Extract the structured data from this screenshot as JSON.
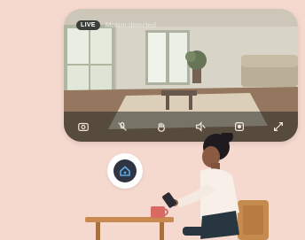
{
  "camera": {
    "live_label": "LIVE",
    "status_text": "Motion detected",
    "controls": [
      {
        "name": "snapshot",
        "icon": "camera-icon"
      },
      {
        "name": "mute-mic",
        "icon": "mic-off-icon"
      },
      {
        "name": "talk",
        "icon": "hand-icon"
      },
      {
        "name": "volume",
        "icon": "speaker-icon"
      },
      {
        "name": "record",
        "icon": "record-icon"
      },
      {
        "name": "fullscreen",
        "icon": "expand-icon"
      }
    ]
  },
  "home_button": {
    "icon": "home-icon"
  },
  "colors": {
    "background": "#f5d9cf",
    "home_button_fill": "#2f3542",
    "home_accent": "#5aa9e6",
    "sweater": "#f7efe8",
    "table": "#c98a52",
    "chair": "#c58a4d"
  }
}
